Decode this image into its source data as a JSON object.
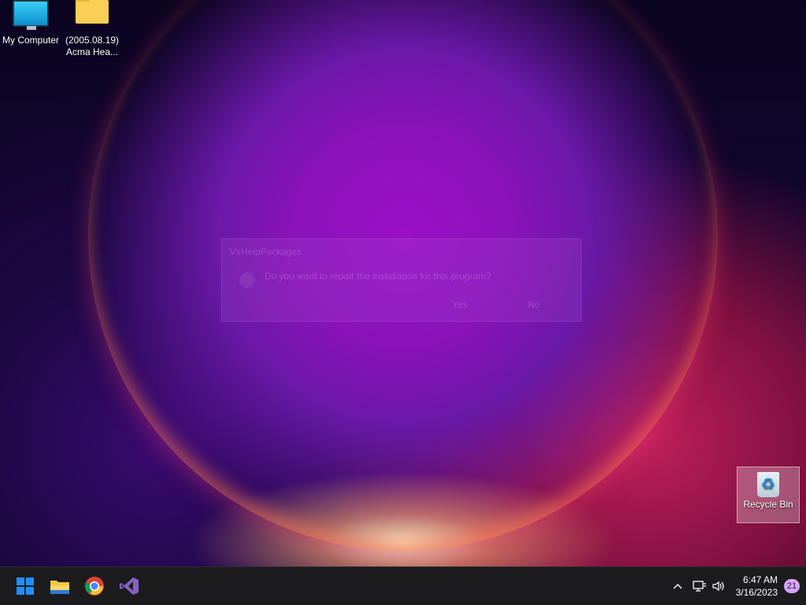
{
  "desktop": {
    "icons": [
      {
        "label": "My Computer",
        "icon": "monitor-icon"
      },
      {
        "label": "(2005.08.19)\nAcma Hea...",
        "icon": "folder-icon"
      }
    ],
    "recycle_bin": {
      "label": "Recycle Bin",
      "icon": "recycle-bin-icon"
    }
  },
  "dialog": {
    "title": "VsHelpPackages",
    "message": "Do you want to repair the installation for this program?",
    "yes_label": "Yes",
    "no_label": "No"
  },
  "taskbar": {
    "apps": [
      {
        "name": "start",
        "icon": "windows-logo-icon"
      },
      {
        "name": "file-explorer",
        "icon": "folder-icon"
      },
      {
        "name": "chrome",
        "icon": "chrome-icon"
      },
      {
        "name": "visual-studio",
        "icon": "visual-studio-icon"
      }
    ],
    "tray": {
      "time": "6:47 AM",
      "date": "3/16/2023",
      "notification_count": "21"
    }
  },
  "colors": {
    "taskbar_bg": "#1c1c1e",
    "badge": "#d9a3ff",
    "accent_windows": "#1e90ff"
  }
}
